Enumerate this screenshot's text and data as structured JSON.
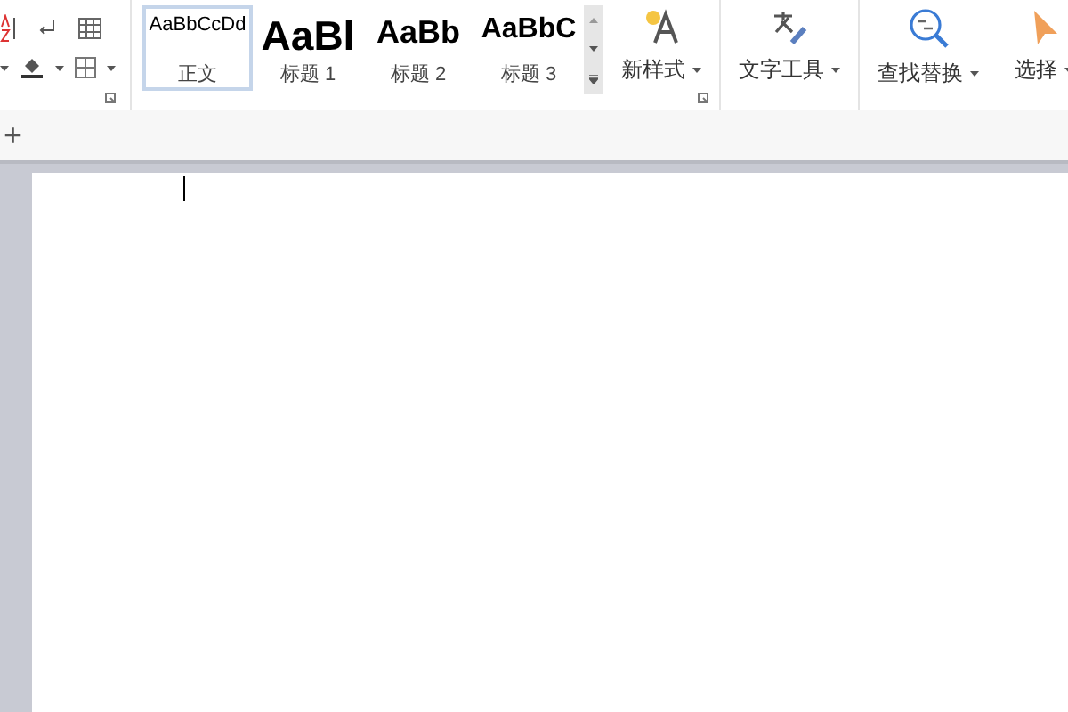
{
  "styles": [
    {
      "preview": "AaBbCcDd",
      "label": "正文",
      "selected": true,
      "kind": "small"
    },
    {
      "preview": "AaBl",
      "label": "标题 1",
      "selected": false,
      "kind": "h1"
    },
    {
      "preview": "AaBb",
      "label": "标题 2",
      "selected": false,
      "kind": "h2"
    },
    {
      "preview": "AaBbC",
      "label": "标题 3",
      "selected": false,
      "kind": "h3"
    }
  ],
  "tools": [
    {
      "label": "新样式",
      "kind": "new-style"
    },
    {
      "label": "文字工具",
      "kind": "text-tools"
    },
    {
      "label": "查找替换",
      "kind": "find-replace"
    },
    {
      "label": "选择",
      "kind": "select"
    }
  ],
  "add_symbol": "+"
}
